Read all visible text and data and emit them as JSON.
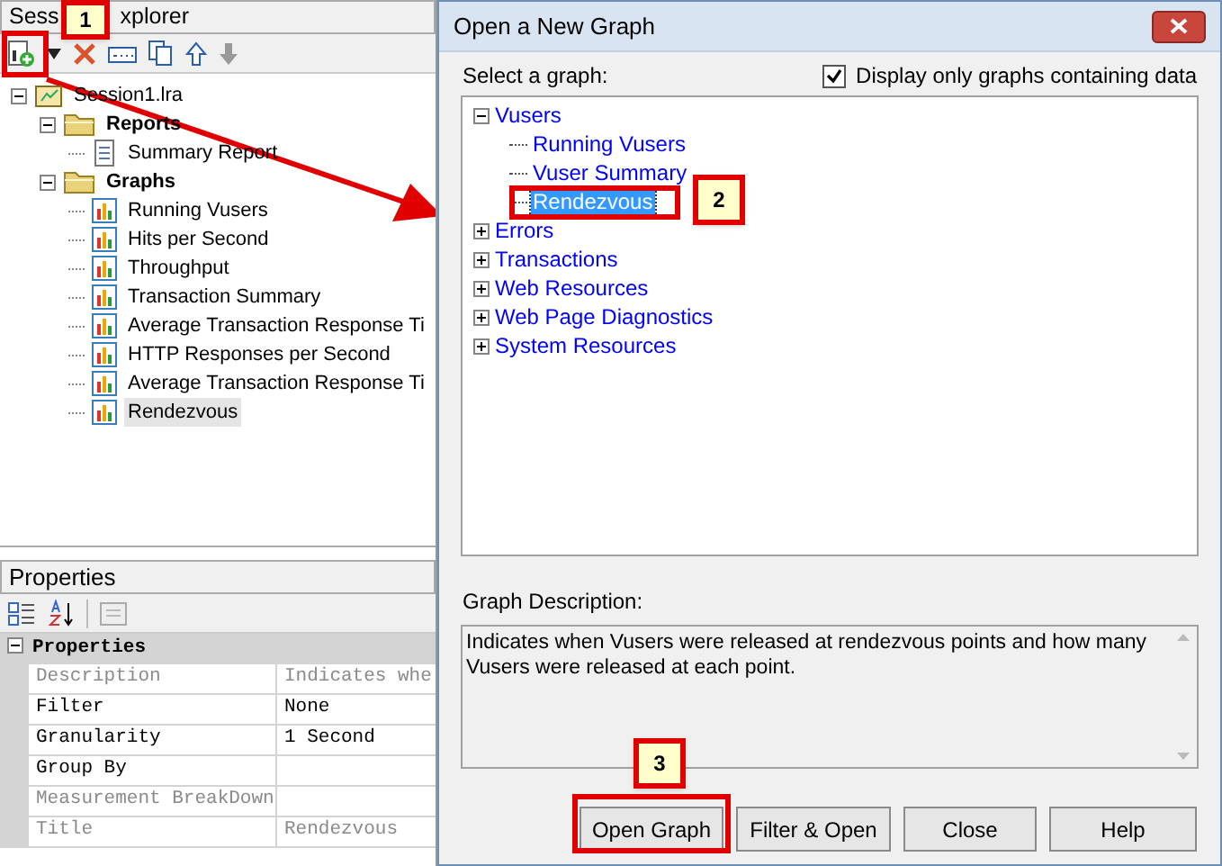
{
  "explorer": {
    "title_parts": [
      "Sess",
      "xplorer"
    ],
    "tree": [
      {
        "label": "Session1.lra",
        "kind": "session",
        "expanded": true,
        "selected": false,
        "children": [
          {
            "label": "Reports",
            "kind": "folder",
            "expanded": true,
            "selected": false,
            "children": [
              {
                "label": "Summary Report",
                "kind": "report",
                "selected": false
              }
            ]
          },
          {
            "label": "Graphs",
            "kind": "folder",
            "expanded": true,
            "selected": false,
            "children": [
              {
                "label": "Running Vusers",
                "kind": "graph",
                "selected": false
              },
              {
                "label": "Hits per Second",
                "kind": "graph",
                "selected": false
              },
              {
                "label": "Throughput",
                "kind": "graph",
                "selected": false
              },
              {
                "label": "Transaction Summary",
                "kind": "graph",
                "selected": false
              },
              {
                "label": "Average Transaction Response Ti",
                "kind": "graph",
                "selected": false
              },
              {
                "label": "HTTP Responses per Second",
                "kind": "graph",
                "selected": false
              },
              {
                "label": "Average Transaction Response Ti",
                "kind": "graph",
                "selected": false
              },
              {
                "label": "Rendezvous",
                "kind": "graph",
                "selected": true
              }
            ]
          }
        ]
      }
    ]
  },
  "properties": {
    "title": "Properties",
    "category": {
      "label": "Properties",
      "expanded": true
    },
    "rows": [
      {
        "name": "Description",
        "value": "Indicates whe",
        "disabled": true
      },
      {
        "name": "Filter",
        "value": "None",
        "disabled": false
      },
      {
        "name": "Granularity",
        "value": "1 Second",
        "disabled": false
      },
      {
        "name": "Group By",
        "disabled": false
      },
      {
        "name": "Measurement BreakDown",
        "disabled": true
      },
      {
        "name": "Title",
        "value": "Rendezvous",
        "disabled": true
      }
    ]
  },
  "dialog": {
    "title": "Open a New Graph",
    "select_label": "Select a graph:",
    "filter_checkbox": {
      "label": "Display only graphs containing data",
      "checked": true
    },
    "tree": [
      {
        "label": "Vusers",
        "expanded": true,
        "children": [
          {
            "label": "Running Vusers",
            "selected": false
          },
          {
            "label": "Vuser Summary",
            "selected": false
          },
          {
            "label": "Rendezvous",
            "selected": true
          }
        ]
      },
      {
        "label": "Errors",
        "expanded": false
      },
      {
        "label": "Transactions",
        "expanded": false
      },
      {
        "label": "Web Resources",
        "expanded": false
      },
      {
        "label": "Web Page Diagnostics",
        "expanded": false
      },
      {
        "label": "System Resources",
        "expanded": false
      }
    ],
    "description_label": "Graph Description:",
    "description": "Indicates when Vusers were released at rendezvous points and how many Vusers were released at each point.",
    "buttons": [
      "Open Graph",
      "Filter & Open",
      "Close",
      "Help"
    ]
  },
  "annotations": [
    {
      "label": "1"
    },
    {
      "label": "2"
    },
    {
      "label": "3"
    }
  ]
}
